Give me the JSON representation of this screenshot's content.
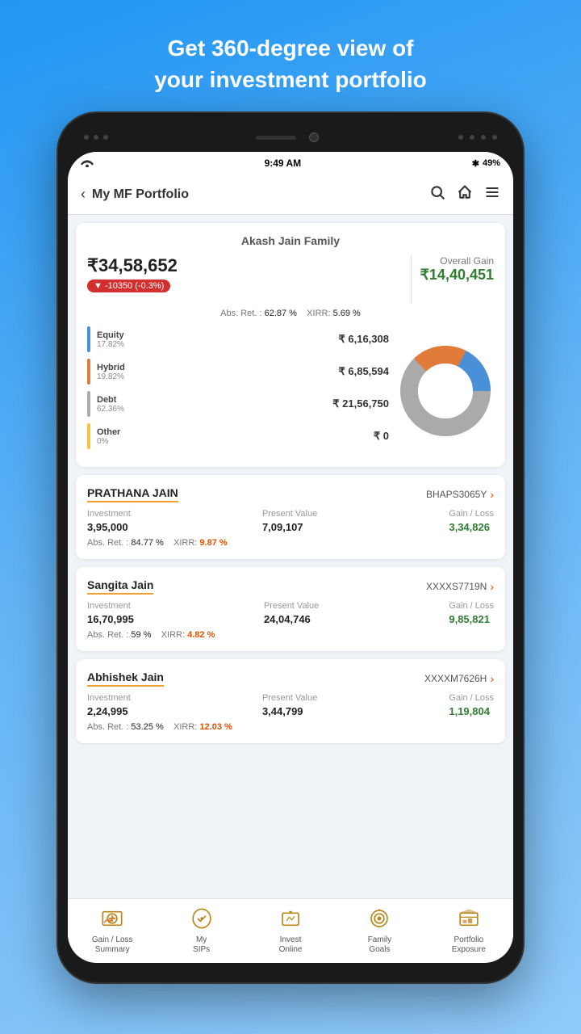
{
  "header": {
    "line1": "Get 360-degree view of",
    "line2": "your investment portfolio"
  },
  "statusBar": {
    "wifi": "wifi",
    "time": "9:49 AM",
    "bluetooth": "✱",
    "battery": "49%"
  },
  "navbar": {
    "backLabel": "‹",
    "title": "My MF Portfolio",
    "searchIcon": "🔍",
    "homeIcon": "⌂",
    "menuIcon": "≡"
  },
  "portfolio": {
    "familyName": "Akash Jain Family",
    "totalValue": "₹34,58,652",
    "change": "▼ -10350  (-0.3%)",
    "overallGainLabel": "Overall Gain",
    "overallGainValue": "₹14,40,451",
    "absRet": "62.87 %",
    "xirr": "5.69 %",
    "segments": [
      {
        "name": "Equity",
        "pct": "17.82%",
        "value": "₹ 6,16,308",
        "color": "#4a90d9"
      },
      {
        "name": "Hybrid",
        "pct": "19.82%",
        "value": "₹ 6,85,594",
        "color": "#e07b39"
      },
      {
        "name": "Debt",
        "pct": "62.36%",
        "value": "₹ 21,56,750",
        "color": "#aaaaaa"
      },
      {
        "name": "Other",
        "pct": "0%",
        "value": "₹ 0",
        "color": "#f5c542"
      }
    ]
  },
  "members": [
    {
      "name": "PRATHANA JAIN",
      "id": "BHAPS3065Y",
      "investment": "3,95,000",
      "presentValue": "7,09,107",
      "gainLoss": "3,34,826",
      "absRet": "84.77 %",
      "xirr": "9.87 %"
    },
    {
      "name": "Sangita Jain",
      "id": "XXXXS7719N",
      "investment": "16,70,995",
      "presentValue": "24,04,746",
      "gainLoss": "9,85,821",
      "absRet": "59 %",
      "xirr": "4.82 %"
    },
    {
      "name": "Abhishek Jain",
      "id": "XXXXM7626H",
      "investment": "2,24,995",
      "presentValue": "3,44,799",
      "gainLoss": "1,19,804",
      "absRet": "53.25 %",
      "xirr": "12.03 %"
    }
  ],
  "bottomNav": [
    {
      "label": "Gain / Loss\nSummary",
      "icon": "gainloss"
    },
    {
      "label": "My\nSIPs",
      "icon": "sips"
    },
    {
      "label": "Invest\nOnline",
      "icon": "invest"
    },
    {
      "label": "Family\nGoals",
      "icon": "goals"
    },
    {
      "label": "Portfolio\nExposure",
      "icon": "exposure"
    }
  ]
}
